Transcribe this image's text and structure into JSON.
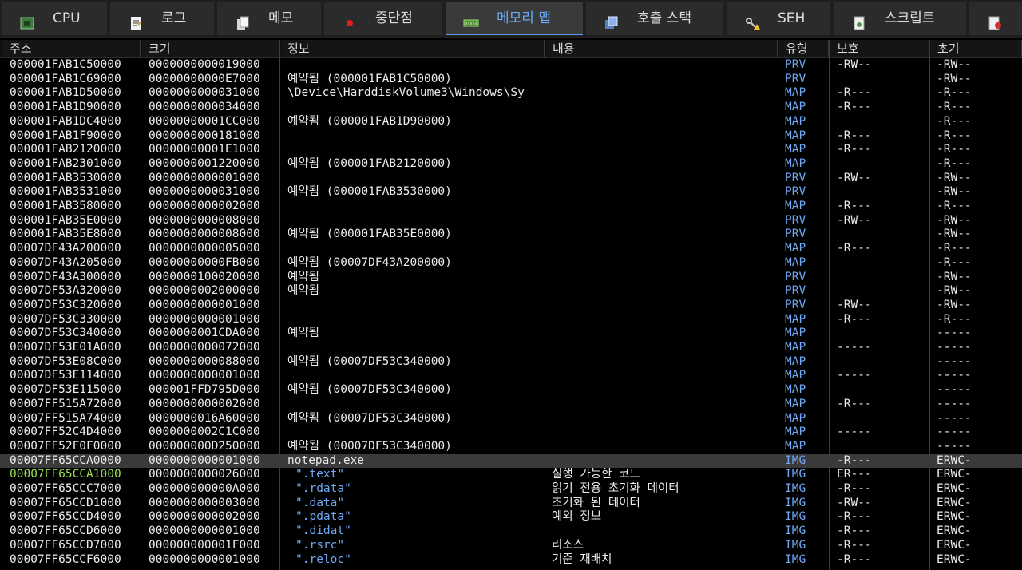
{
  "tabs": [
    {
      "label": "CPU",
      "icon": "cpu-icon",
      "active": false
    },
    {
      "label": "로그",
      "icon": "log-icon",
      "active": false
    },
    {
      "label": "메모",
      "icon": "notes-icon",
      "active": false
    },
    {
      "label": "중단점",
      "icon": "breakpoint-icon",
      "active": false
    },
    {
      "label": "메모리 맵",
      "icon": "memory-map-icon",
      "active": true
    },
    {
      "label": "호출 스택",
      "icon": "call-stack-icon",
      "active": false
    },
    {
      "label": "SEH",
      "icon": "seh-icon",
      "active": false
    },
    {
      "label": "스크립트",
      "icon": "script-icon",
      "active": false
    },
    {
      "label": "",
      "icon": "symbols-icon",
      "active": false
    }
  ],
  "columns": [
    "주소",
    "크기",
    "정보",
    "내용",
    "유형",
    "보호",
    "초기"
  ],
  "colors": {
    "accent": "#5b9bf0",
    "type_text": "#6fa8f5",
    "highlight_address": "#9be04f",
    "selected_row": "#3a3a3a"
  },
  "rows": [
    {
      "addr": "000001FAB1C50000",
      "size": "0000000000019000",
      "info": "",
      "content": "",
      "type": "PRV",
      "prot": "-RW--",
      "init": "-RW--"
    },
    {
      "addr": "000001FAB1C69000",
      "size": "00000000000E7000",
      "info": "예약됨 (000001FAB1C50000)",
      "content": "",
      "type": "PRV",
      "prot": "",
      "init": "-RW--"
    },
    {
      "addr": "000001FAB1D50000",
      "size": "0000000000031000",
      "info": "\\Device\\HarddiskVolume3\\Windows\\Sy",
      "content": "",
      "type": "MAP",
      "prot": "-R---",
      "init": "-R---"
    },
    {
      "addr": "000001FAB1D90000",
      "size": "0000000000034000",
      "info": "",
      "content": "",
      "type": "MAP",
      "prot": "-R---",
      "init": "-R---"
    },
    {
      "addr": "000001FAB1DC4000",
      "size": "00000000001CC000",
      "info": "예약됨 (000001FAB1D90000)",
      "content": "",
      "type": "MAP",
      "prot": "",
      "init": "-R---"
    },
    {
      "addr": "000001FAB1F90000",
      "size": "0000000000181000",
      "info": "",
      "content": "",
      "type": "MAP",
      "prot": "-R---",
      "init": "-R---"
    },
    {
      "addr": "000001FAB2120000",
      "size": "00000000001E1000",
      "info": "",
      "content": "",
      "type": "MAP",
      "prot": "-R---",
      "init": "-R---"
    },
    {
      "addr": "000001FAB2301000",
      "size": "0000000001220000",
      "info": "예약됨 (000001FAB2120000)",
      "content": "",
      "type": "MAP",
      "prot": "",
      "init": "-R---"
    },
    {
      "addr": "000001FAB3530000",
      "size": "0000000000001000",
      "info": "",
      "content": "",
      "type": "PRV",
      "prot": "-RW--",
      "init": "-RW--"
    },
    {
      "addr": "000001FAB3531000",
      "size": "0000000000031000",
      "info": "예약됨 (000001FAB3530000)",
      "content": "",
      "type": "PRV",
      "prot": "",
      "init": "-RW--"
    },
    {
      "addr": "000001FAB3580000",
      "size": "0000000000002000",
      "info": "",
      "content": "",
      "type": "MAP",
      "prot": "-R---",
      "init": "-R---"
    },
    {
      "addr": "000001FAB35E0000",
      "size": "0000000000008000",
      "info": "",
      "content": "",
      "type": "PRV",
      "prot": "-RW--",
      "init": "-RW--"
    },
    {
      "addr": "000001FAB35E8000",
      "size": "0000000000008000",
      "info": "예약됨 (000001FAB35E0000)",
      "content": "",
      "type": "PRV",
      "prot": "",
      "init": "-RW--"
    },
    {
      "addr": "00007DF43A200000",
      "size": "0000000000005000",
      "info": "",
      "content": "",
      "type": "MAP",
      "prot": "-R---",
      "init": "-R---"
    },
    {
      "addr": "00007DF43A205000",
      "size": "00000000000FB000",
      "info": "예약됨 (00007DF43A200000)",
      "content": "",
      "type": "MAP",
      "prot": "",
      "init": "-R---"
    },
    {
      "addr": "00007DF43A300000",
      "size": "0000000100020000",
      "info": "예약됨",
      "content": "",
      "type": "PRV",
      "prot": "",
      "init": "-RW--"
    },
    {
      "addr": "00007DF53A320000",
      "size": "0000000002000000",
      "info": "예약됨",
      "content": "",
      "type": "PRV",
      "prot": "",
      "init": "-RW--"
    },
    {
      "addr": "00007DF53C320000",
      "size": "0000000000001000",
      "info": "",
      "content": "",
      "type": "PRV",
      "prot": "-RW--",
      "init": "-RW--"
    },
    {
      "addr": "00007DF53C330000",
      "size": "0000000000001000",
      "info": "",
      "content": "",
      "type": "MAP",
      "prot": "-R---",
      "init": "-R---"
    },
    {
      "addr": "00007DF53C340000",
      "size": "0000000001CDA000",
      "info": "예약됨",
      "content": "",
      "type": "MAP",
      "prot": "",
      "init": "-----"
    },
    {
      "addr": "00007DF53E01A000",
      "size": "0000000000072000",
      "info": "",
      "content": "",
      "type": "MAP",
      "prot": "-----",
      "init": "-----"
    },
    {
      "addr": "00007DF53E08C000",
      "size": "0000000000088000",
      "info": "예약됨 (00007DF53C340000)",
      "content": "",
      "type": "MAP",
      "prot": "",
      "init": "-----"
    },
    {
      "addr": "00007DF53E114000",
      "size": "0000000000001000",
      "info": "",
      "content": "",
      "type": "MAP",
      "prot": "-----",
      "init": "-----"
    },
    {
      "addr": "00007DF53E115000",
      "size": "000001FFD795D000",
      "info": "예약됨 (00007DF53C340000)",
      "content": "",
      "type": "MAP",
      "prot": "",
      "init": "-----"
    },
    {
      "addr": "00007FF515A72000",
      "size": "0000000000002000",
      "info": "",
      "content": "",
      "type": "MAP",
      "prot": "-R---",
      "init": "-----"
    },
    {
      "addr": "00007FF515A74000",
      "size": "0000000016A60000",
      "info": "예약됨 (00007DF53C340000)",
      "content": "",
      "type": "MAP",
      "prot": "",
      "init": "-----"
    },
    {
      "addr": "00007FF52C4D4000",
      "size": "0000000002C1C000",
      "info": "",
      "content": "",
      "type": "MAP",
      "prot": "-----",
      "init": "-----"
    },
    {
      "addr": "00007FF52F0F0000",
      "size": "000000000D250000",
      "info": "예약됨 (00007DF53C340000)",
      "content": "",
      "type": "MAP",
      "prot": "",
      "init": "-----"
    },
    {
      "addr": "00007FF65CCA0000",
      "size": "0000000000001000",
      "info": "notepad.exe",
      "content": "",
      "type": "IMG",
      "prot": "-R---",
      "init": "ERWC-",
      "selected": true
    },
    {
      "addr": "00007FF65CCA1000",
      "size": "0000000000026000",
      "info": "\".text\"",
      "content": "실행 가능한 코드",
      "type": "IMG",
      "prot": "ER---",
      "init": "ERWC-",
      "green": true,
      "section": true
    },
    {
      "addr": "00007FF65CCC7000",
      "size": "000000000000A000",
      "info": "\".rdata\"",
      "content": "읽기 전용 초기화 데이터",
      "type": "IMG",
      "prot": "-R---",
      "init": "ERWC-",
      "section": true
    },
    {
      "addr": "00007FF65CCD1000",
      "size": "0000000000003000",
      "info": "\".data\"",
      "content": "초기화 된 데이터",
      "type": "IMG",
      "prot": "-RW--",
      "init": "ERWC-",
      "section": true
    },
    {
      "addr": "00007FF65CCD4000",
      "size": "0000000000002000",
      "info": "\".pdata\"",
      "content": "예외 정보",
      "type": "IMG",
      "prot": "-R---",
      "init": "ERWC-",
      "section": true
    },
    {
      "addr": "00007FF65CCD6000",
      "size": "0000000000001000",
      "info": "\".didat\"",
      "content": "",
      "type": "IMG",
      "prot": "-R---",
      "init": "ERWC-",
      "section": true
    },
    {
      "addr": "00007FF65CCD7000",
      "size": "000000000001F000",
      "info": "\".rsrc\"",
      "content": "리소스",
      "type": "IMG",
      "prot": "-R---",
      "init": "ERWC-",
      "section": true
    },
    {
      "addr": "00007FF65CCF6000",
      "size": "0000000000001000",
      "info": "\".reloc\"",
      "content": "기준 재배치",
      "type": "IMG",
      "prot": "-R---",
      "init": "ERWC-",
      "section": true
    }
  ]
}
